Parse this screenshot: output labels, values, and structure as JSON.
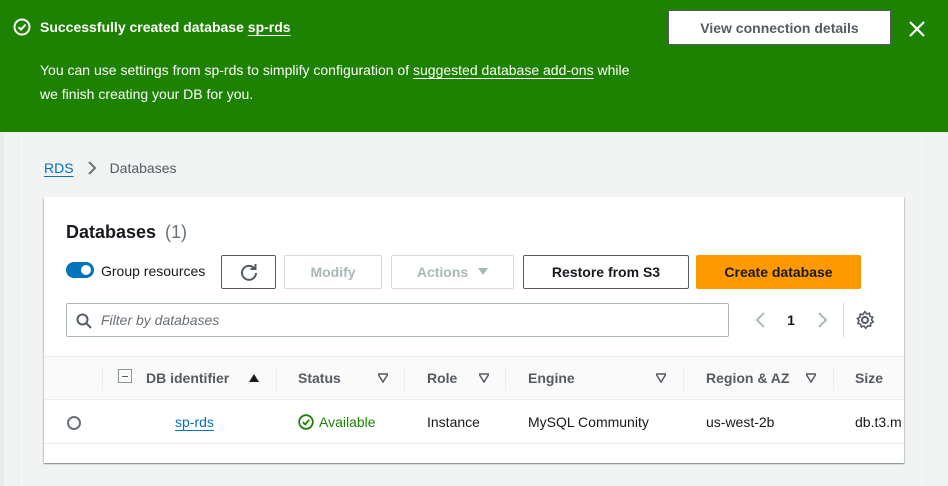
{
  "flash": {
    "title_prefix": "Successfully created database ",
    "title_link": "sp-rds",
    "body_prefix": "You can use settings from sp-rds to simplify configuration of ",
    "body_link": "suggested database add-ons",
    "body_suffix": " while we finish creating your DB for you.",
    "view_button": "View connection details",
    "color": "#1d8102"
  },
  "breadcrumb": {
    "root": "RDS",
    "current": "Databases"
  },
  "panel": {
    "title": "Databases",
    "count": "(1)",
    "group_toggle_label": "Group resources",
    "group_toggle_on": true,
    "buttons": {
      "modify": "Modify",
      "actions": "Actions",
      "restore": "Restore from S3",
      "create": "Create database"
    },
    "filter_placeholder": "Filter by databases",
    "page": "1"
  },
  "table": {
    "columns": [
      "DB identifier",
      "Status",
      "Role",
      "Engine",
      "Region & AZ",
      "Size"
    ],
    "rows": [
      {
        "db_identifier": "sp-rds",
        "status": "Available",
        "role": "Instance",
        "engine": "MySQL Community",
        "region_az": "us-west-2b",
        "size": "db.t3.m"
      }
    ]
  },
  "colors": {
    "accent_link": "#0073bb",
    "primary_button": "#ff9900",
    "success": "#1d8102"
  }
}
